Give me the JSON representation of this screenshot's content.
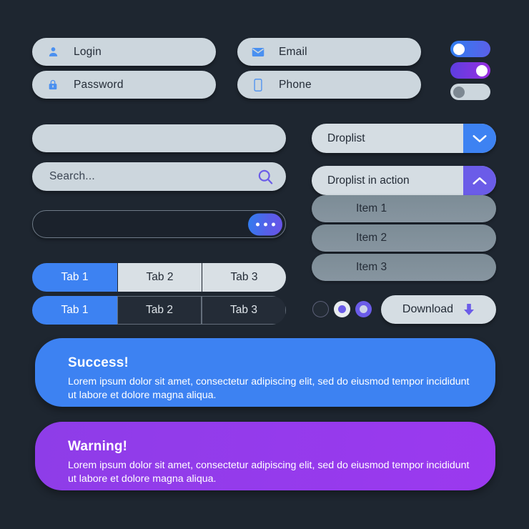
{
  "background": "#1e2630",
  "accents": {
    "blue": "#3d82f2",
    "purple": "#6b5ce8",
    "light": "#ccd6dd",
    "warning_purple": "#9b39ef"
  },
  "fields": {
    "login": {
      "label": "Login",
      "icon": "user-icon"
    },
    "password": {
      "label": "Password",
      "icon": "lock-icon"
    },
    "email": {
      "label": "Email",
      "icon": "envelope-icon"
    },
    "phone": {
      "label": "Phone",
      "icon": "smartphone-icon"
    },
    "empty": {
      "value": "",
      "placeholder": ""
    },
    "search": {
      "placeholder": "Search...",
      "icon": "search-icon"
    },
    "message": {
      "value": "",
      "placeholder": "",
      "action_icon": "ellipsis-icon"
    }
  },
  "toggles": [
    {
      "name": "toggle-blue",
      "state": "off",
      "color": "#3d82f2"
    },
    {
      "name": "toggle-purple",
      "state": "on",
      "color": "#8e3de8"
    },
    {
      "name": "toggle-gray",
      "state": "off",
      "color": "#ccd6dd"
    }
  ],
  "droplist": {
    "closed": {
      "label": "Droplist",
      "icon": "chevron-down-icon"
    },
    "open": {
      "label": "Droplist in action",
      "icon": "chevron-up-icon"
    },
    "items": [
      {
        "label": "Item 1"
      },
      {
        "label": "Item 2"
      },
      {
        "label": "Item 3"
      }
    ]
  },
  "tabs_light": [
    {
      "label": "Tab 1",
      "active": true
    },
    {
      "label": "Tab 2",
      "active": false
    },
    {
      "label": "Tab 3",
      "active": false
    }
  ],
  "tabs_dark": [
    {
      "label": "Tab 1",
      "active": true
    },
    {
      "label": "Tab 2",
      "active": false
    },
    {
      "label": "Tab 3",
      "active": false
    }
  ],
  "radios": [
    {
      "name": "radio-unselected",
      "state": "unselected"
    },
    {
      "name": "radio-selected-light",
      "state": "selected"
    },
    {
      "name": "radio-selected-filled",
      "state": "selected"
    }
  ],
  "download": {
    "label": "Download",
    "icon": "download-arrow-icon"
  },
  "alerts": {
    "success": {
      "title": "Success!",
      "body": "Lorem ipsum dolor sit amet, consectetur adipiscing elit, sed do eiusmod tempor incididunt ut labore et dolore magna aliqua."
    },
    "warning": {
      "title": "Warning!",
      "body": "Lorem ipsum dolor sit amet, consectetur adipiscing elit, sed do eiusmod tempor incididunt ut labore et dolore magna aliqua."
    }
  }
}
